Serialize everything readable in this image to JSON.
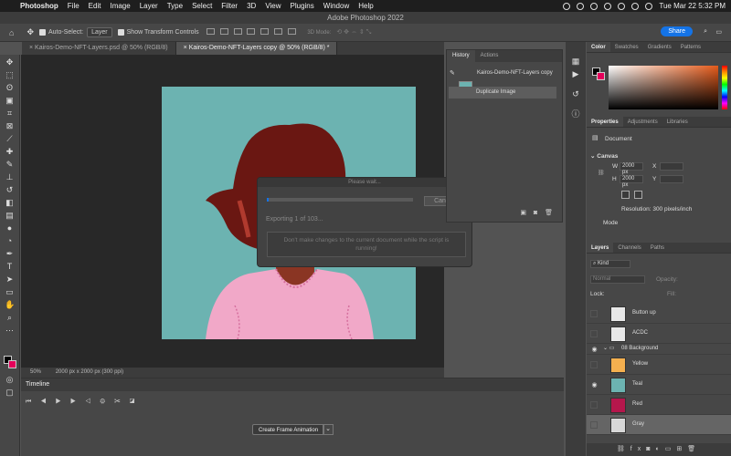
{
  "menubar": {
    "app_name": "Photoshop",
    "items": [
      "File",
      "Edit",
      "Image",
      "Layer",
      "Type",
      "Select",
      "Filter",
      "3D",
      "View",
      "Plugins",
      "Window",
      "Help"
    ],
    "clock": "Tue Mar 22  5:32 PM"
  },
  "window": {
    "title": "Adobe Photoshop 2022"
  },
  "options": {
    "auto_select_label": "Auto-Select:",
    "auto_select_value": "Layer",
    "transform_label": "Show Transform Controls",
    "mode_3d": "3D Mode:",
    "share_label": "Share"
  },
  "tabs": [
    {
      "label": "Kairos-Demo-NFT-Layers.psd @ 50% (RGB/8)"
    },
    {
      "label": "Kairos-Demo-NFT-Layers copy @ 50% (RGB/8) *"
    }
  ],
  "status": {
    "zoom": "50%",
    "doc_size": "2000 px x 2000 px (300 ppi)"
  },
  "timeline": {
    "title": "Timeline",
    "create_frame_label": "Create Frame Animation"
  },
  "dialog": {
    "title": "Please wait...",
    "cancel_label": "Cancel",
    "progress_text": "Exporting 1 of 103...",
    "progress": 0.01,
    "warning": "Don't make changes to the current document while the script is running!"
  },
  "history": {
    "tabs": [
      "History",
      "Actions"
    ],
    "snapshot_label": "Kairos-Demo-NFT-Layers copy",
    "items": [
      "Duplicate Image"
    ]
  },
  "color_panel": {
    "tabs": [
      "Color",
      "Swatches",
      "Gradients",
      "Patterns"
    ],
    "foreground": "#000000",
    "background": "#e4005a"
  },
  "properties": {
    "tabs": [
      "Properties",
      "Adjustments",
      "Libraries"
    ],
    "type_label": "Document",
    "section": "Canvas",
    "w_label": "W",
    "w_value": "2000 px",
    "h_label": "H",
    "h_value": "2000 px",
    "x_label": "X",
    "y_label": "Y",
    "resolution": "Resolution: 300 pixels/inch",
    "mode": "Mode"
  },
  "layers": {
    "tabs": [
      "Layers",
      "Channels",
      "Paths"
    ],
    "filter": "Kind",
    "blend": "Normal",
    "opacity_label": "Opacity:",
    "lock_label": "Lock:",
    "fill_label": "Fill:",
    "rows": [
      {
        "name": "Button up",
        "color": "#e8e8e8",
        "visible": false
      },
      {
        "name": "ACDC",
        "color": "#e8e8e8",
        "visible": false
      },
      {
        "name": "08 Background",
        "color": "",
        "visible": true
      },
      {
        "name": "Yellow",
        "color": "#f5b04f",
        "visible": false
      },
      {
        "name": "Teal",
        "color": "#6cb3b1",
        "visible": true
      },
      {
        "name": "Red",
        "color": "#b5174c",
        "visible": false
      },
      {
        "name": "Gray",
        "color": "#d8d8d8",
        "visible": false
      }
    ]
  }
}
